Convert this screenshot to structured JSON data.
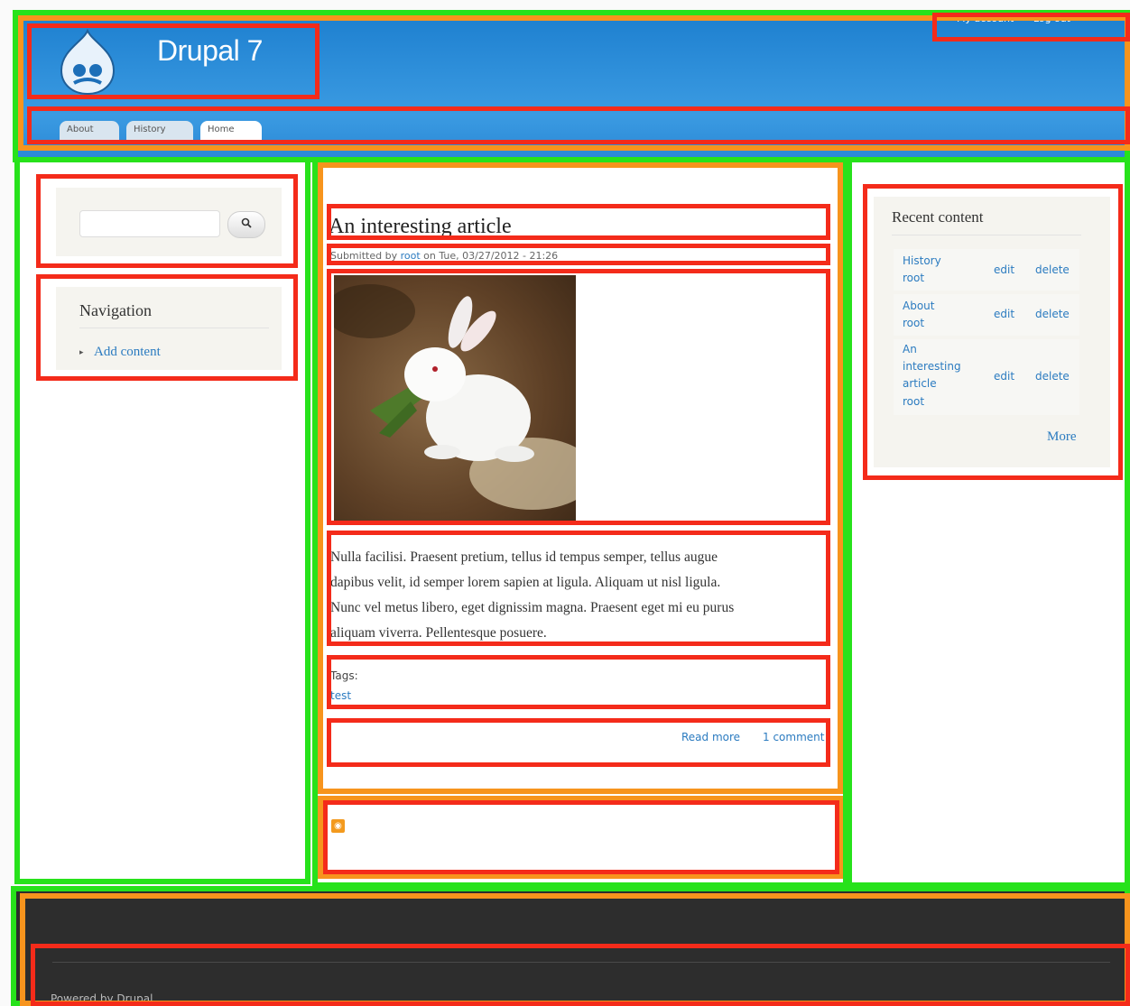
{
  "header": {
    "site_name": "Drupal 7",
    "secondary_menu": [
      "My account",
      "Log out"
    ],
    "tabs": [
      "About",
      "History",
      "Home"
    ]
  },
  "sidebar_first": {
    "search": {
      "placeholder": "",
      "button_icon": "search-icon"
    },
    "navigation": {
      "title": "Navigation",
      "items": [
        "Add content"
      ]
    }
  },
  "article": {
    "title": "An interesting article",
    "meta_prefix": "Submitted by ",
    "meta_author": "root",
    "meta_suffix": " on Tue, 03/27/2012 - 21:26",
    "image": "white-rabbit-photo",
    "body_lines": [
      "Nulla facilisi. Praesent pretium, tellus id tempus semper, tellus augue",
      "dapibus velit, id semper lorem sapien at ligula. Aliquam ut nisl ligula.",
      "Nunc vel metus libero, eget dignissim magna. Praesent eget mi eu purus",
      "aliquam viverra. Pellentesque posuere."
    ],
    "tags_label": "Tags:",
    "tags": [
      "test"
    ],
    "links": {
      "read_more": "Read more",
      "comments": "1 comment"
    },
    "feed_icon": "rss-icon"
  },
  "sidebar_second": {
    "recent_content": {
      "title": "Recent content",
      "rows": [
        {
          "title": "History",
          "author": "root",
          "edit": "edit",
          "delete": "delete"
        },
        {
          "title": "About",
          "author": "root",
          "edit": "edit",
          "delete": "delete"
        },
        {
          "title": "An interesting article",
          "author": "root",
          "edit": "edit",
          "delete": "delete"
        }
      ],
      "more": "More"
    }
  },
  "footer": {
    "credit": "Powered by Drupal"
  },
  "colors": {
    "header": "#2a88d6",
    "link": "#2b7bc0",
    "footer": "#2d2d2d",
    "outline_green": "#27e21b",
    "outline_orange": "#f7941d",
    "outline_red": "#f42b1a"
  }
}
